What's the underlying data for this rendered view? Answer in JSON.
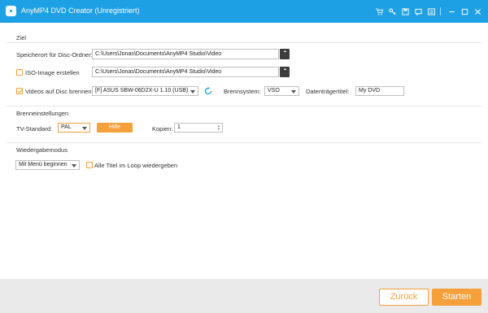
{
  "window": {
    "title": "AnyMP4 DVD Creator (Unregistriert)",
    "icons": [
      "cart-icon",
      "key-icon",
      "save-icon",
      "feedback-icon",
      "menu-icon",
      "minimize-icon",
      "maximize-icon",
      "close-icon"
    ]
  },
  "target": {
    "section_label": "Ziel",
    "folder_label": "Speicherort für Disc-Ordner:",
    "folder_path": "C:\\Users\\Jonas\\Documents\\AnyMP4 Studio\\Video",
    "iso_label": "ISO-Image erstellen",
    "iso_checked": false,
    "iso_path": "C:\\Users\\Jonas\\Documents\\AnyMP4 Studio\\Video",
    "burn_label": "Videos auf Disc brennen",
    "burn_checked": true,
    "drive_value": "[F] ASUS SBW-06D2X-U 1.10 (USB)",
    "filesystem_label": "Brennsystem:",
    "filesystem_value": "VSO",
    "volume_label": "Datenträgertitel:",
    "volume_value": "My DVD"
  },
  "burn_settings": {
    "section_label": "Brenneinstellungen",
    "tv_label": "TV-Standard:",
    "tv_value": "PAL",
    "help_label": "Hilfe",
    "copies_label": "Kopien:",
    "copies_value": "1"
  },
  "playback": {
    "section_label": "Wiedergabemodus",
    "mode_value": "Mit Menü beginnen",
    "loop_label": "Alle Titel im Loop wiedergeben",
    "loop_checked": false
  },
  "footer": {
    "back_label": "Zurück",
    "start_label": "Starten"
  },
  "colors": {
    "titlebar": "#1ea0e4",
    "accent": "#f5a03a"
  }
}
